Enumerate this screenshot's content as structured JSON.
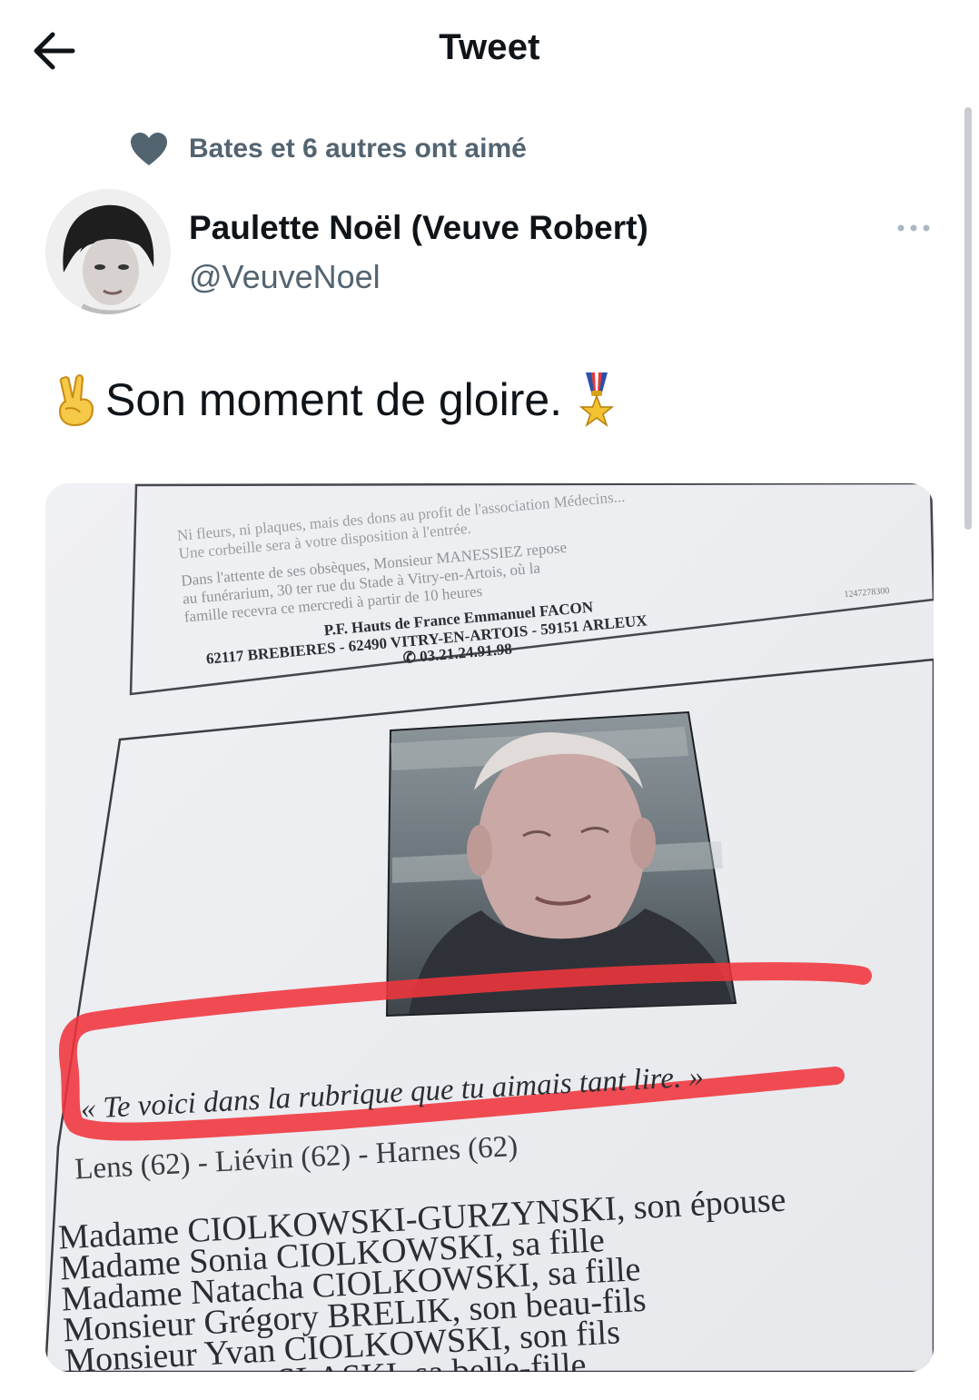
{
  "header": {
    "title": "Tweet"
  },
  "social_context": {
    "text": "Bates et 6 autres ont aimé"
  },
  "author": {
    "name": "Paulette Noël (Veuve Robert)",
    "handle": "@VeuveNoel"
  },
  "tweet": {
    "text": "Son moment de gloire."
  },
  "newspaper": {
    "faint_lines": [
      "Ni fleurs, ni plaques, mais des dons au profit de l'association Médecins...",
      "Une corbeille sera à votre disposition à l'entrée.",
      "Dans l'attente de ses obsèques, Monsieur MANESSIEZ repose",
      "au funérarium, 30 ter rue du Stade à Vitry-en-Artois, où la",
      "famille recevra ce mercredi à partir de 10 heures"
    ],
    "funeral_home": "P.F. Hauts de France Emmanuel FACON",
    "address": "62117 BREBIERES - 62490 VITRY-EN-ARTOIS - 59151 ARLEUX",
    "phone": "✆ 03.21.24.91.98",
    "ref": "1247278300",
    "quote": "« Te voici dans la rubrique que tu aimais tant lire. »",
    "towns": "Lens (62) - Liévin (62) - Harnes (62)",
    "family": [
      "Madame CIOLKOWSKI-GURZYNSKI, son épouse",
      "Madame Sonia CIOLKOWSKI, sa fille",
      "Madame Natacha CIOLKOWSKI, sa fille",
      "Monsieur Grégory BRELIK, son beau-fils",
      "Monsieur Yvan CIOLKOWSKI, son fils",
      "Madame Anne SLASKI, sa belle-fille"
    ]
  },
  "colors": {
    "heart": "#536471",
    "secondary_text": "#536471",
    "highlight": "#f0343c"
  },
  "icons": [
    "back-arrow-icon",
    "heart-icon",
    "more-icon",
    "victory-hand-emoji",
    "military-medal-emoji"
  ]
}
